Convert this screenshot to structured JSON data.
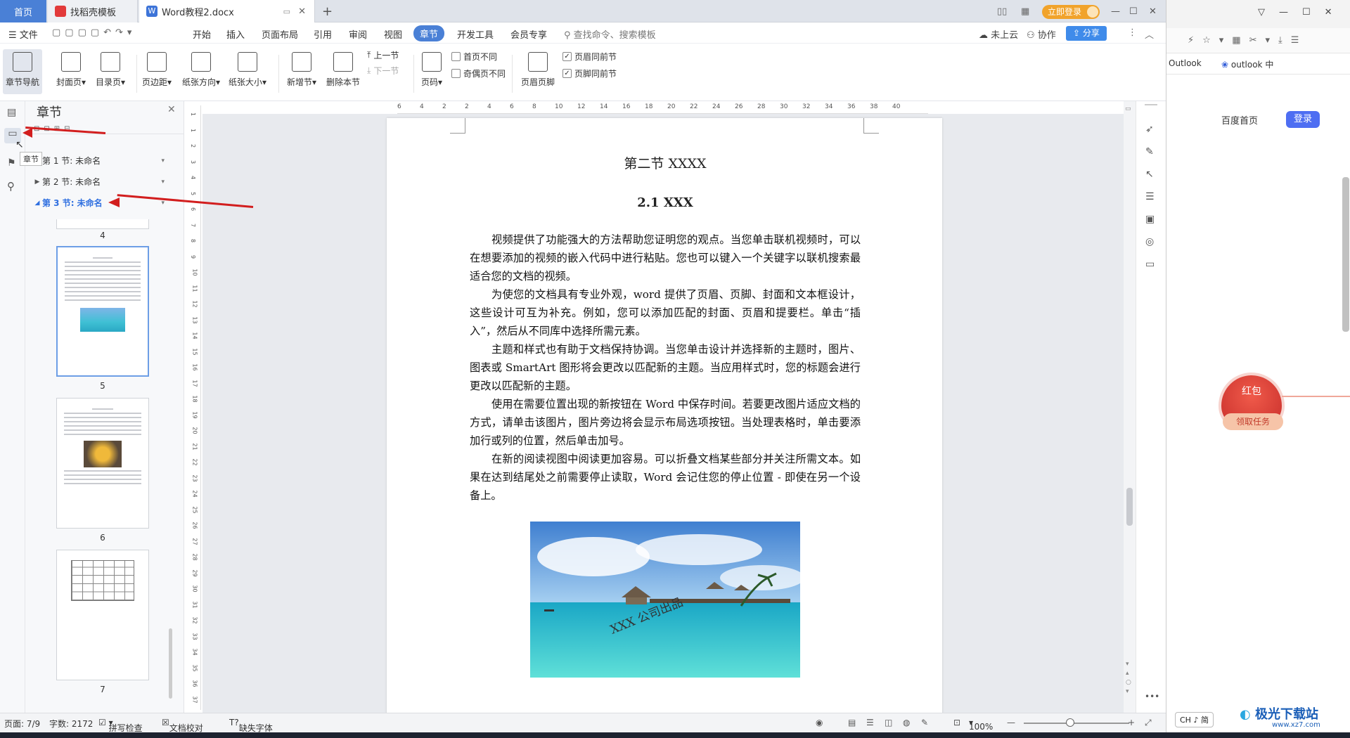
{
  "tabs": {
    "home": "首页",
    "template": "找稻壳模板",
    "doc": "Word教程2.docx"
  },
  "header": {
    "login_btn": "立即登录"
  },
  "menu": {
    "file": "文件",
    "items": [
      "开始",
      "插入",
      "页面布局",
      "引用",
      "审阅",
      "视图",
      "章节",
      "开发工具",
      "会员专享"
    ],
    "active": "章节",
    "search_placeholder": "查找命令、搜索模板",
    "cloud": "未上云",
    "collab": "协作",
    "share": "分享"
  },
  "ribbon": {
    "chapter_nav": "章节导航",
    "cover": "封面页",
    "toc": "目录页",
    "margin": "页边距",
    "orientation": "纸张方向",
    "paper_size": "纸张大小",
    "new_section": "新增节",
    "delete_section": "删除本节",
    "prev_section": "上一节",
    "next_section": "下一节",
    "page_num": "页码",
    "first_diff": "首页不同",
    "odd_even_diff": "奇偶页不同",
    "header_footer": "页眉页脚",
    "header_same": "页眉同前节",
    "footer_same": "页脚同前节"
  },
  "nav": {
    "title": "章节",
    "tooltip": "章节",
    "sections": [
      "第 1 节: 未命名",
      "第 2 节: 未命名",
      "第 3 节: 未命名"
    ],
    "pages": [
      "4",
      "5",
      "6",
      "7"
    ]
  },
  "ruler": {
    "h": [
      "6",
      "4",
      "2",
      "2",
      "4",
      "6",
      "8",
      "10",
      "12",
      "14",
      "16",
      "18",
      "20",
      "22",
      "24",
      "26",
      "28",
      "30",
      "32",
      "34",
      "36",
      "38",
      "40"
    ],
    "v": [
      "1",
      "1",
      "2",
      "3",
      "4",
      "5",
      "6",
      "7",
      "8",
      "9",
      "10",
      "11",
      "12",
      "13",
      "14",
      "15",
      "16",
      "17",
      "18",
      "19",
      "20",
      "21",
      "22",
      "23",
      "24",
      "25",
      "26",
      "27",
      "28",
      "29",
      "30",
      "31",
      "32",
      "33",
      "34",
      "35",
      "36",
      "37"
    ]
  },
  "doc": {
    "heading1": "第二节  XXXX",
    "heading2": "2.1 XXX",
    "paragraphs": [
      "视频提供了功能强大的方法帮助您证明您的观点。当您单击联机视频时，可以在想要添加的视频的嵌入代码中进行粘贴。您也可以键入一个关键字以联机搜索最适合您的文档的视频。",
      "为使您的文档具有专业外观，word 提供了页眉、页脚、封面和文本框设计，这些设计可互为补充。例如，您可以添加匹配的封面、页眉和提要栏。单击“插入”，然后从不同库中选择所需元素。",
      "主题和样式也有助于文档保持协调。当您单击设计并选择新的主题时，图片、图表或 SmartArt 图形将会更改以匹配新的主题。当应用样式时，您的标题会进行更改以匹配新的主题。",
      "使用在需要位置出现的新按钮在 Word 中保存时间。若要更改图片适应文档的方式，请单击该图片，图片旁边将会显示布局选项按钮。当处理表格时，单击要添加行或列的位置，然后单击加号。",
      "在新的阅读视图中阅读更加容易。可以折叠文档某些部分并关注所需文本。如果在达到结尾处之前需要停止读取，Word 会记住您的停止位置 - 即使在另一个设备上。"
    ],
    "watermark": "XXX 公司出品"
  },
  "status": {
    "page": "页面: 7/9",
    "words": "字数: 2172",
    "spell": "拼写检查",
    "proof": "文档校对",
    "font": "缺失字体",
    "zoom": "100%"
  },
  "browser": {
    "tab1": "Outlook",
    "tab2": "outlook 中",
    "baidu": "百度首页",
    "login": "登录",
    "redpack": "红包",
    "task": "领取任务",
    "ime": "CH ♪ 简",
    "logo": "极光下载站",
    "logo_url": "www.xz7.com"
  },
  "colors": {
    "accent": "#4a80d6",
    "arrow": "#d21e1e",
    "login_orange": "#f1a32b"
  }
}
